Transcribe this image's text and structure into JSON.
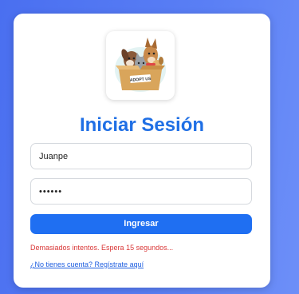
{
  "login": {
    "logo_text": "ADOPT US",
    "title": "Iniciar Sesión",
    "username_value": "Juanpe",
    "password_value": "••••••",
    "submit_label": "Ingresar",
    "error_message": "Demasiados intentos. Espera 15 segundos...",
    "register_link": "¿No tienes cuenta? Regístrate aquí"
  },
  "colors": {
    "background": "#5a7ff5",
    "title": "#1f6fe5",
    "button": "#1f6ff2",
    "error": "#d93838",
    "link": "#1f5fe0"
  },
  "icons": {
    "logo": "adopt-us-pets-in-box-logo"
  }
}
